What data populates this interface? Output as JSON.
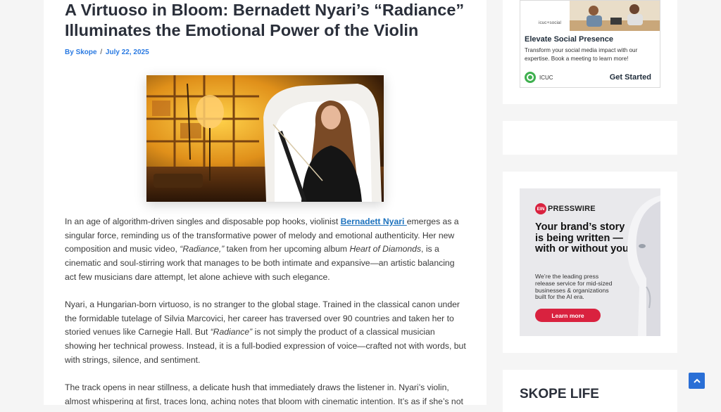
{
  "article": {
    "title": "A Virtuoso in Bloom: Bernadett Nyari’s “Radiance” Illuminates the Emotional Power of the Violin",
    "byline": {
      "prefix": "By ",
      "author": "Skope",
      "separator": "/",
      "date": "July 22, 2025"
    },
    "image": {
      "icon": "violinist-photo"
    },
    "paragraphs": {
      "p1": {
        "t1": "In an age of algorithm-driven singles and disposable pop hooks, violinist ",
        "link": "Bernadett Nyari ",
        "t2": "emerges as a singular force, reminding us of the transformative power of melody and emotional authenticity. Her new composition and music video, ",
        "em1": "“Radiance,”",
        "t3": " taken from her upcoming album ",
        "em2": "Heart of Diamonds",
        "t4": ", is a cinematic and soul-stirring work that manages to be both intimate and expansive—an artistic balancing act few musicians dare attempt, let alone achieve with such elegance."
      },
      "p2": {
        "t1": "Nyari, a Hungarian-born virtuoso, is no stranger to the global stage. Trained in the classical canon under the formidable tutelage of Silvia Marcovici, her career has traversed over 90 countries and taken her to storied venues like Carnegie Hall. But ",
        "em1": "“Radiance”",
        "t2": " is not simply the product of a classical musician showing her technical prowess. Instead, it is a full-bodied expression of voice—crafted not with words, but with strings, silence, and sentiment."
      },
      "p3": {
        "t1": "The track opens in near stillness, a delicate hush that immediately draws the listener in. Nyari’s violin, almost whispering at first, traces long, aching notes that bloom with cinematic intention. It’s as if she’s not"
      }
    }
  },
  "sidebar": {
    "ad1": {
      "mini_logo": "icuc+social",
      "headline": "Elevate Social Presence",
      "description": "Transform your social media impact with our expertise. Book a meeting to learn more!",
      "brand": "ICUC",
      "cta": "Get Started"
    },
    "ad2": {
      "logo_badge": "EIN",
      "logo_text": "PRESSWIRE",
      "headline": "Your brand’s story is being written — with or without you.",
      "subtext": "We’re the leading press release service for mid-sized businesses & organizations built for the AI era.",
      "cta": "Learn more"
    },
    "section_title": "SKOPE LIFE"
  },
  "icons": {
    "scroll_top": "chevron-up-icon"
  },
  "colors": {
    "link": "#1e73be",
    "byline": "#2a7ae2",
    "ein_red": "#d9223f",
    "scroll_button": "#2a6fd6"
  }
}
